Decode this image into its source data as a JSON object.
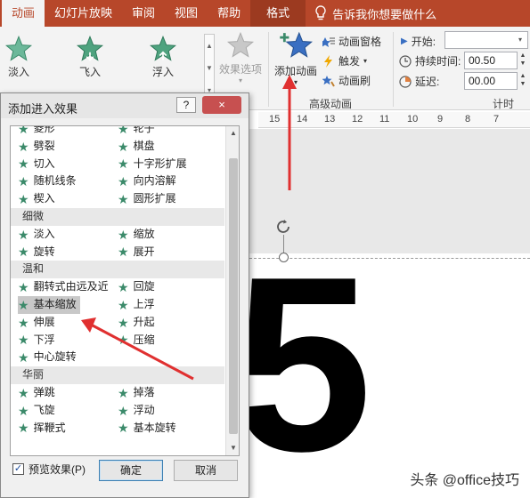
{
  "ribbon_tabs": [
    {
      "label": "动画"
    },
    {
      "label": "幻灯片放映"
    },
    {
      "label": "审阅"
    },
    {
      "label": "视图"
    },
    {
      "label": "帮助"
    },
    {
      "label": "格式"
    }
  ],
  "tell_me": "告诉我你想要做什么",
  "ribbon": {
    "gallery": [
      "淡入",
      "飞入",
      "浮入"
    ],
    "effect_options": "效果选项",
    "add_animation": "添加动画",
    "animation_pane": "动画窗格",
    "trigger": "触发",
    "anim_painter": "动画刷",
    "advanced_group": "高级动画",
    "start_label": "开始:",
    "start_value": "",
    "duration_label": "持续时间:",
    "duration_value": "00.50",
    "delay_label": "延迟:",
    "delay_value": "00.00",
    "timing_group": "计时"
  },
  "ruler": {
    "marks": [
      "15",
      "14",
      "13",
      "12",
      "11",
      "10",
      "9",
      "8",
      "7"
    ]
  },
  "slide": {
    "big_text": "5"
  },
  "watermark": "头条 @office技巧",
  "dialog": {
    "title": "添加进入效果",
    "help": "?",
    "close": "×",
    "sections": [
      {
        "kind": "rows",
        "rows": [
          [
            "菱形",
            "轮子"
          ],
          [
            "劈裂",
            "棋盘"
          ],
          [
            "切入",
            "十字形扩展"
          ],
          [
            "随机线条",
            "向内溶解"
          ],
          [
            "楔入",
            "圆形扩展"
          ]
        ]
      },
      {
        "kind": "category",
        "label": "细微"
      },
      {
        "kind": "rows",
        "rows": [
          [
            "淡入",
            "缩放"
          ],
          [
            "旋转",
            "展开"
          ]
        ]
      },
      {
        "kind": "category",
        "label": "温和"
      },
      {
        "kind": "rows",
        "rows": [
          [
            "翻转式由远及近",
            "回旋"
          ],
          [
            "基本缩放",
            "上浮"
          ],
          [
            "伸展",
            "升起"
          ],
          [
            "下浮",
            "压缩"
          ],
          [
            "中心旋转",
            ""
          ]
        ]
      },
      {
        "kind": "category",
        "label": "华丽"
      },
      {
        "kind": "rows",
        "rows": [
          [
            "弹跳",
            "掉落"
          ],
          [
            "飞旋",
            "浮动"
          ],
          [
            "挥鞭式",
            "基本旋转"
          ]
        ]
      }
    ],
    "selected_item": "基本缩放",
    "preview_label": "预览效果(P)",
    "preview_checked": true,
    "ok": "确定",
    "cancel": "取消"
  },
  "colors": {
    "accent": "#b7472a",
    "star": "#3b8a6a",
    "arrow": "#e03030"
  }
}
